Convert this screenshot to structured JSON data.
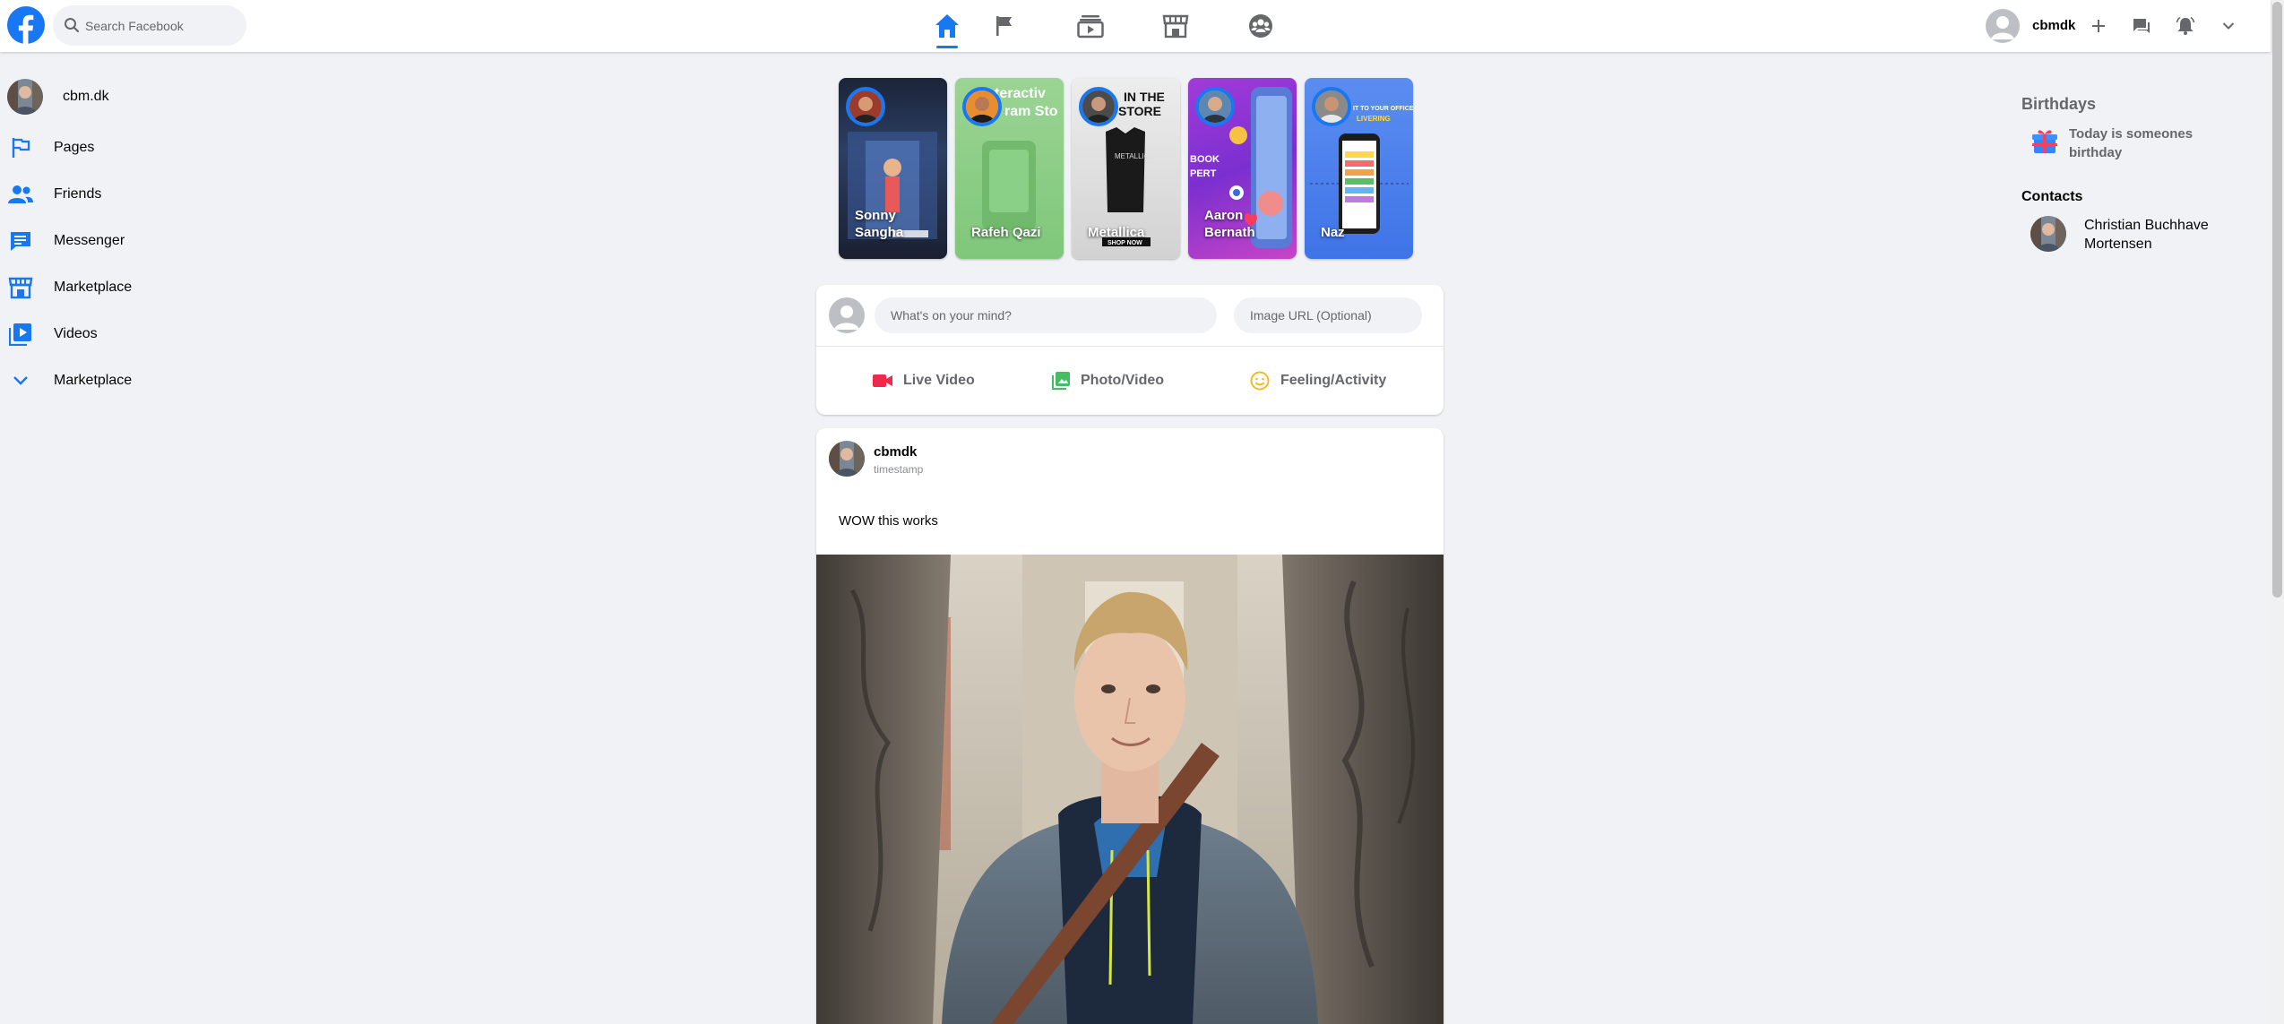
{
  "header": {
    "search_placeholder": "Search Facebook",
    "user_name": "cbmdk",
    "nav": [
      "home-icon",
      "flag-icon",
      "watch-icon",
      "marketplace-icon",
      "groups-icon"
    ],
    "accent": "#1877f2"
  },
  "sidebar": {
    "profile_name": "cbm.dk",
    "items": [
      {
        "label": "Pages",
        "icon": "flag-outline-icon"
      },
      {
        "label": "Friends",
        "icon": "friends-icon"
      },
      {
        "label": "Messenger",
        "icon": "messenger-icon"
      },
      {
        "label": "Marketplace",
        "icon": "storefront-icon"
      },
      {
        "label": "Videos",
        "icon": "video-library-icon"
      },
      {
        "label": "Marketplace",
        "icon": "chevron-down-icon"
      }
    ]
  },
  "stories": [
    {
      "name": "Sonny Sangha"
    },
    {
      "name": "Rafeh Qazi"
    },
    {
      "name": "Metallica"
    },
    {
      "name": "Aaron Bernath"
    },
    {
      "name": "Naz"
    }
  ],
  "composer": {
    "text_placeholder": "What's on your mind?",
    "image_placeholder": "Image URL (Optional)",
    "actions": [
      "Live Video",
      "Photo/Video",
      "Feeling/Activity"
    ]
  },
  "post": {
    "author": "cbmdk",
    "timestamp": "timestamp",
    "message": "WOW this works"
  },
  "rightbar": {
    "birthdays_title": "Birthdays",
    "birthday_text": "Today is someones birthday",
    "contacts_title": "Contacts",
    "contact_name": "Christian Buchhave Mortensen"
  }
}
